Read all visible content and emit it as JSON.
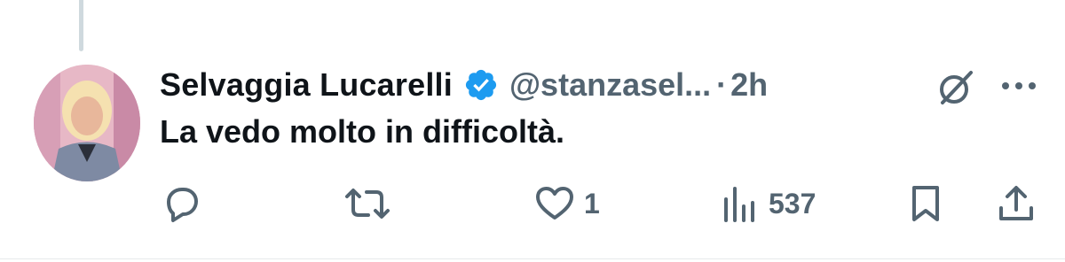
{
  "post": {
    "author_name": "Selvaggia Lucarelli",
    "handle": "@stanzasel...",
    "separator": "·",
    "time": "2h",
    "text": "La vedo molto in difficoltà.",
    "verified": true
  },
  "actions": {
    "reply_count": "",
    "repost_count": "",
    "like_count": "1",
    "views_count": "537"
  },
  "colors": {
    "text": "#0f1419",
    "muted": "#536471",
    "verified": "#1d9bf0"
  },
  "icons": [
    "reply-icon",
    "repost-icon",
    "like-icon",
    "views-icon",
    "bookmark-icon",
    "share-icon",
    "grok-icon",
    "more-icon",
    "verified-badge-icon"
  ]
}
